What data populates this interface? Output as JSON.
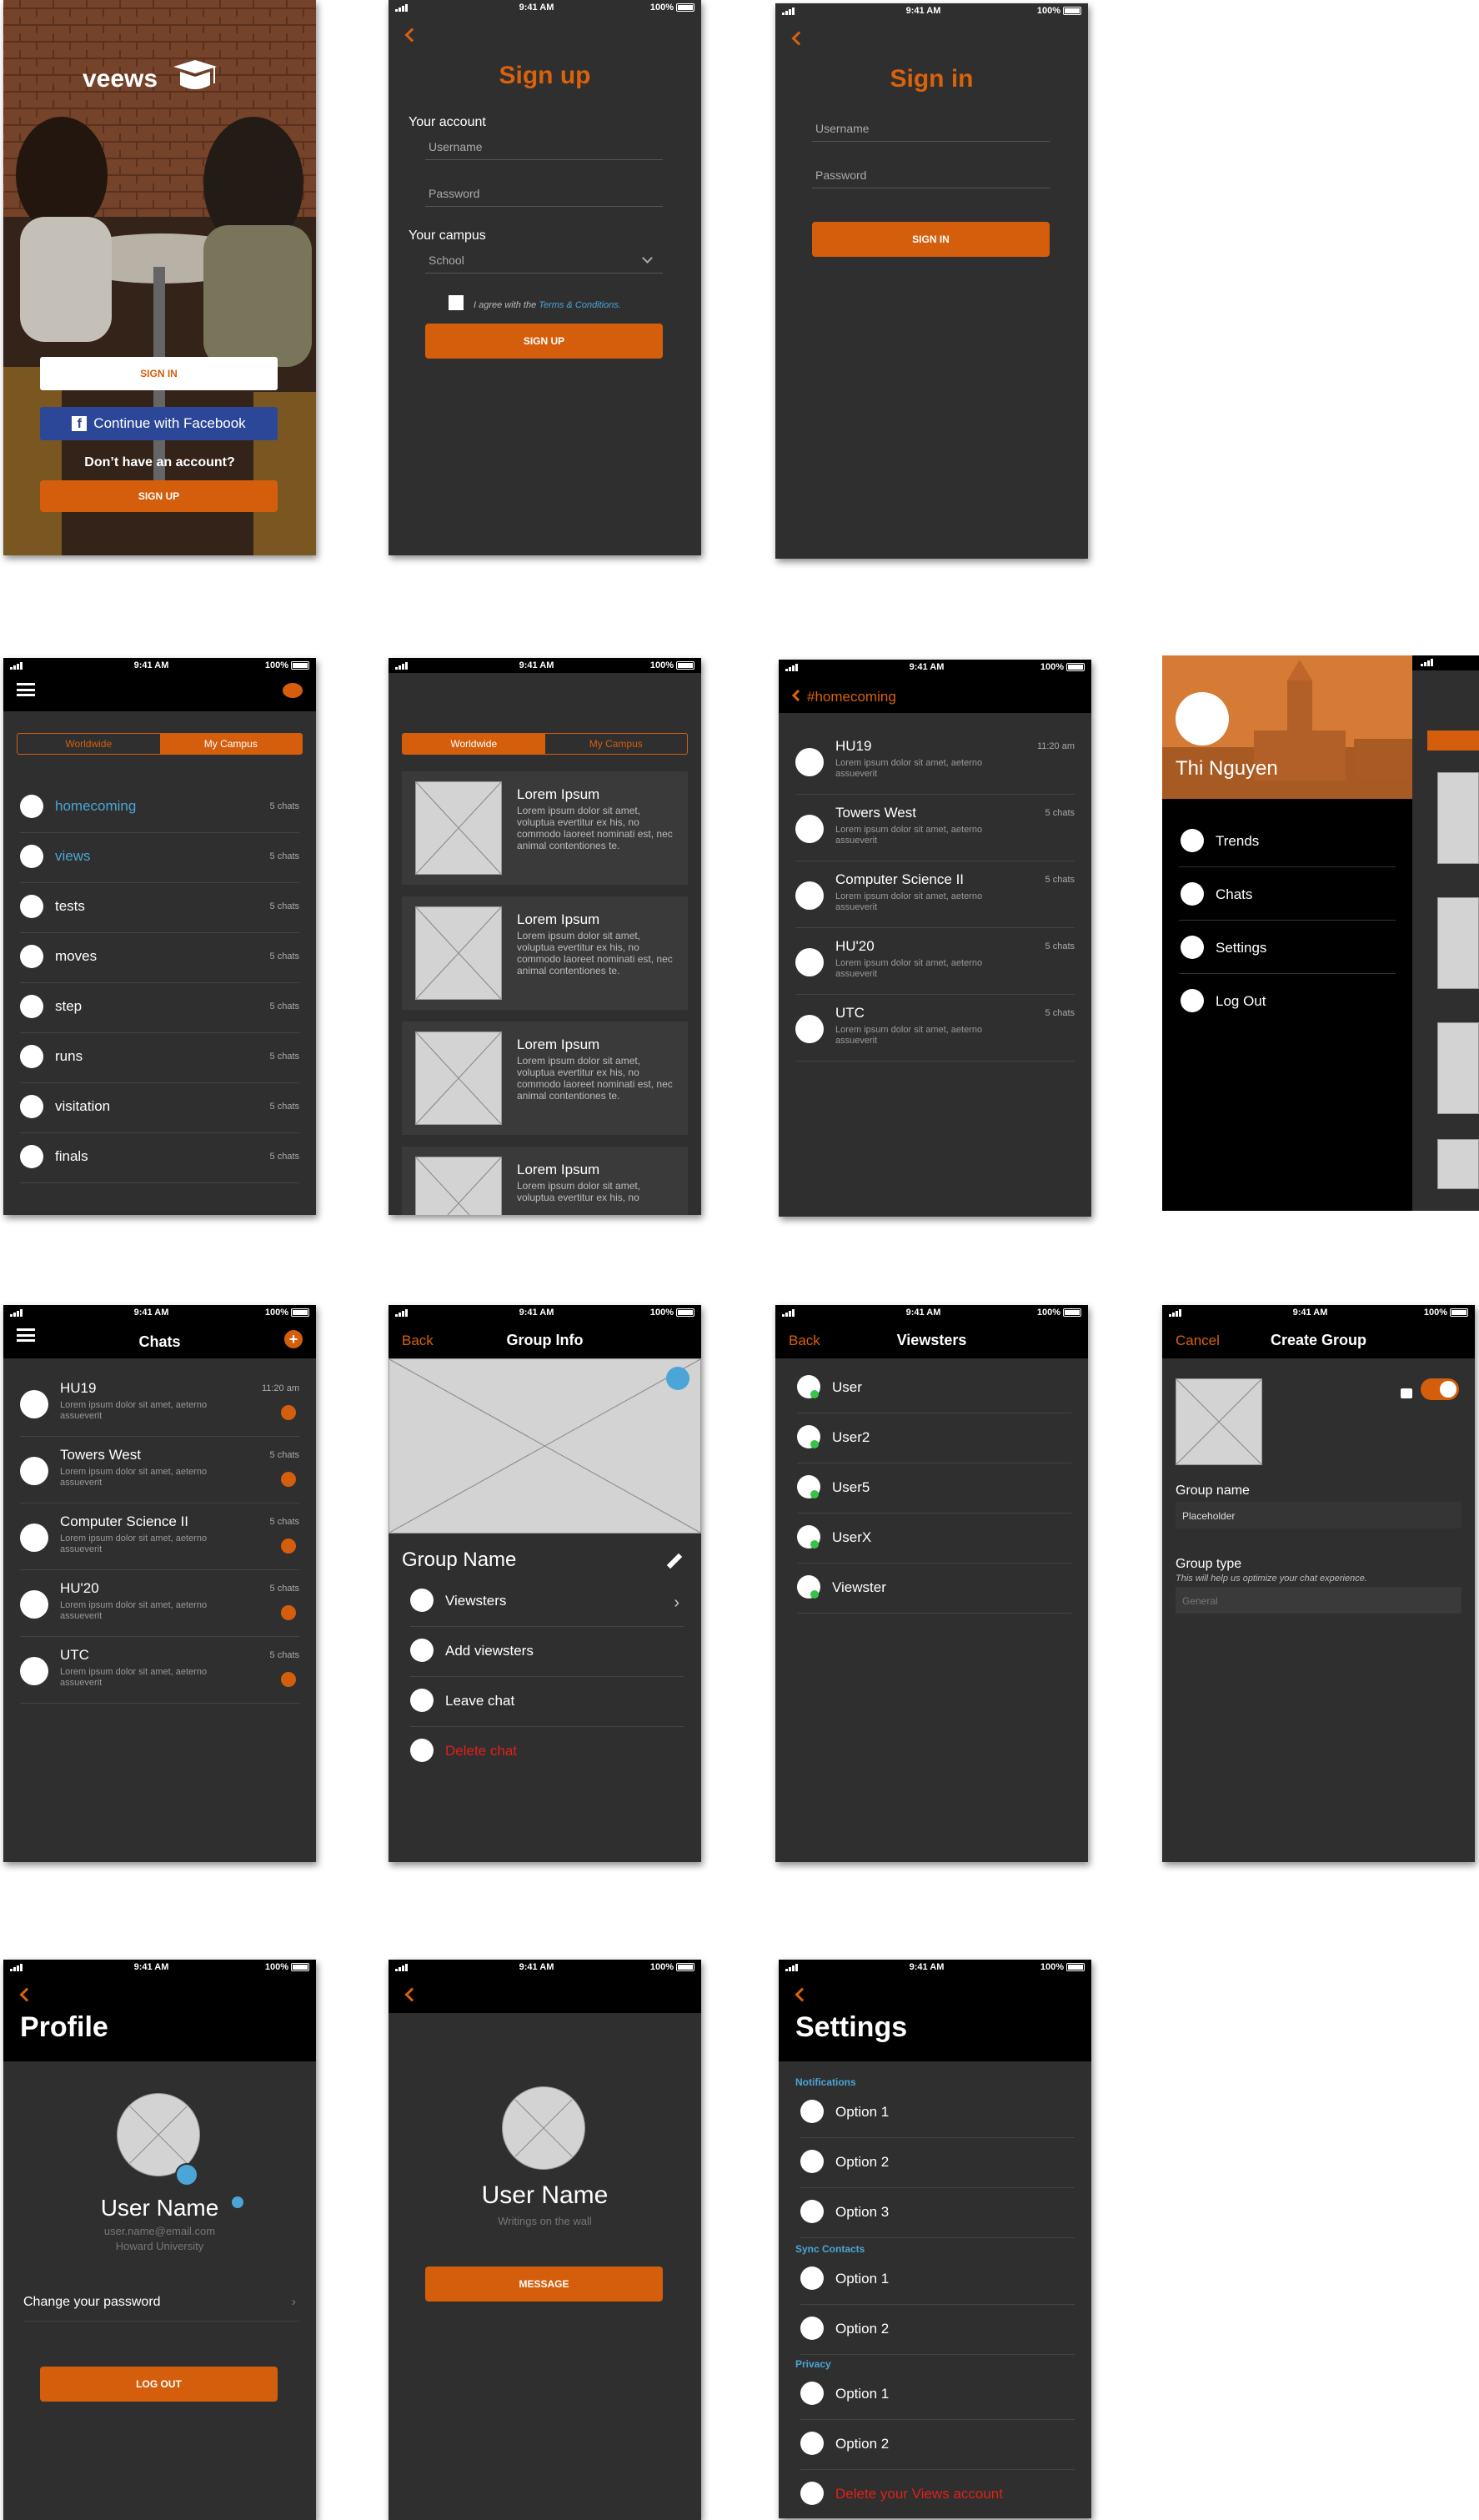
{
  "status": {
    "time": "9:41 AM",
    "battery": "100%"
  },
  "splash": {
    "logo": "veews",
    "sign_in": "SIGN IN",
    "facebook": "Continue with Facebook",
    "no_account": "Don’t have an account?",
    "sign_up": "SIGN UP"
  },
  "signup": {
    "title": "Sign up",
    "account_label": "Your account",
    "username_placeholder": "Username",
    "password_placeholder": "Password",
    "campus_label": "Your campus",
    "school_placeholder": "School",
    "agree_prefix": "I agree with the ",
    "terms": "Terms & Conditions.",
    "button": "SIGN UP"
  },
  "signin": {
    "title": "Sign in",
    "username_placeholder": "Username",
    "password_placeholder": "Password",
    "button": "SIGN IN"
  },
  "campus": {
    "tabs": [
      "Worldwide",
      "My Campus"
    ],
    "items": [
      {
        "name": "homecoming",
        "count": "5 chats",
        "highlight": true
      },
      {
        "name": "views",
        "count": "5 chats",
        "highlight": true
      },
      {
        "name": "tests",
        "count": "5 chats"
      },
      {
        "name": "moves",
        "count": "5 chats"
      },
      {
        "name": "step",
        "count": "5 chats"
      },
      {
        "name": "runs",
        "count": "5 chats"
      },
      {
        "name": "visitation",
        "count": "5 chats"
      },
      {
        "name": "finals",
        "count": "5 chats"
      }
    ]
  },
  "feed": {
    "tabs": [
      "Worldwide",
      "My Campus"
    ],
    "cards": [
      {
        "title": "Lorem Ipsum",
        "text": "Lorem ipsum dolor sit amet, voluptua evertitur ex his, no commodo laoreet nominati est, nec animal contentiones te."
      },
      {
        "title": "Lorem Ipsum",
        "text": "Lorem ipsum dolor sit amet, voluptua evertitur ex his, no commodo laoreet nominati est, nec animal contentiones te."
      },
      {
        "title": "Lorem Ipsum",
        "text": "Lorem ipsum dolor sit amet, voluptua evertitur ex his, no commodo laoreet nominati est, nec animal contentiones te."
      },
      {
        "title": "Lorem Ipsum",
        "text": "Lorem ipsum dolor sit amet, voluptua evertitur ex his, no"
      }
    ]
  },
  "hashtag": {
    "title": "#homecoming",
    "items": [
      {
        "name": "HU19",
        "sub": "Lorem ipsum dolor sit amet, aeterno assueverit",
        "meta": "11:20 am"
      },
      {
        "name": "Towers West",
        "sub": "Lorem ipsum dolor sit amet, aeterno assueverit",
        "meta": "5 chats"
      },
      {
        "name": "Computer Science II",
        "sub": "Lorem ipsum dolor sit amet, aeterno assueverit",
        "meta": "5 chats"
      },
      {
        "name": "HU'20",
        "sub": "Lorem ipsum dolor sit amet, aeterno assueverit",
        "meta": "5 chats"
      },
      {
        "name": "UTC",
        "sub": "Lorem ipsum dolor sit amet, aeterno assueverit",
        "meta": "5 chats"
      }
    ]
  },
  "drawer": {
    "user": "Thi Nguyen",
    "items": [
      "Trends",
      "Chats",
      "Settings",
      "Log Out"
    ]
  },
  "chats": {
    "title": "Chats",
    "items": [
      {
        "name": "HU19",
        "sub": "Lorem ipsum dolor sit amet, aeterno assueverit",
        "meta": "11:20 am"
      },
      {
        "name": "Towers West",
        "sub": "Lorem ipsum dolor sit amet, aeterno assueverit",
        "meta": "5 chats"
      },
      {
        "name": "Computer Science II",
        "sub": "Lorem ipsum dolor sit amet, aeterno assueverit",
        "meta": "5 chats"
      },
      {
        "name": "HU'20",
        "sub": "Lorem ipsum dolor sit amet, aeterno assueverit",
        "meta": "5 chats"
      },
      {
        "name": "UTC",
        "sub": "Lorem ipsum dolor sit amet, aeterno assueverit",
        "meta": "5 chats"
      }
    ]
  },
  "group_info": {
    "back": "Back",
    "title": "Group Info",
    "group_name": "Group Name",
    "items": [
      "Viewsters",
      "Add viewsters",
      "Leave chat",
      "Delete chat"
    ]
  },
  "viewsters": {
    "back": "Back",
    "title": "Viewsters",
    "items": [
      "User",
      "User2",
      "User5",
      "UserX",
      "Viewster"
    ]
  },
  "create_group": {
    "cancel": "Cancel",
    "title": "Create Group",
    "name_label": "Group name",
    "name_placeholder": "Placeholder",
    "type_label": "Group type",
    "type_hint": "This will help us optimize your chat experience.",
    "type_value": "General"
  },
  "profile": {
    "title": "Profile",
    "user": "User Name",
    "email": "user.name@email.com",
    "school": "Howard University",
    "change_pw": "Change your password",
    "logout": "LOG OUT"
  },
  "other_profile": {
    "user": "User Name",
    "tagline": "Writings on the wall",
    "button": "MESSAGE"
  },
  "settings": {
    "title": "Settings",
    "notifications": "Notifications",
    "notif_opts": [
      "Option 1",
      "Option 2",
      "Option 3"
    ],
    "sync": "Sync Contacts",
    "sync_opts": [
      "Option 1",
      "Option 2"
    ],
    "privacy": "Privacy",
    "privacy_opts": [
      "Option 1",
      "Option 2"
    ],
    "delete": "Delete your Views account"
  }
}
